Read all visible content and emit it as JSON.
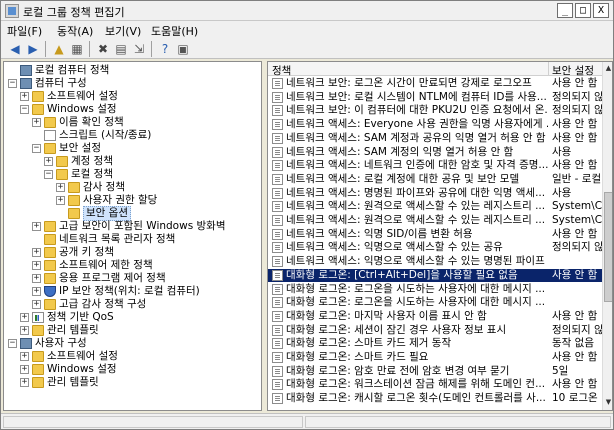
{
  "window": {
    "title": "로컬 그룹 정책 편집기",
    "controls": {
      "minimize": "_",
      "maximize": "□",
      "close": "X"
    }
  },
  "menu": [
    "파일(F)",
    "동작(A)",
    "보기(V)",
    "도움말(H)"
  ],
  "toolbar_icons": [
    "back-icon",
    "forward-icon",
    "up-icon",
    "show-hide-tree-icon",
    "delete-icon",
    "properties-icon",
    "export-icon",
    "help-icon",
    "view-icon"
  ],
  "tree": [
    {
      "label": "로컬 컴퓨터 정책",
      "icon": "computer",
      "exp": ""
    },
    {
      "label": "컴퓨터 구성",
      "icon": "computer",
      "exp": "−"
    },
    {
      "label": "소프트웨어 설정",
      "icon": "folder",
      "exp": "+"
    },
    {
      "label": "Windows 설정",
      "icon": "folder",
      "exp": "−"
    },
    {
      "label": "이름 확인 정책",
      "icon": "folder",
      "exp": "+"
    },
    {
      "label": "스크립트 (시작/종료)",
      "icon": "doc",
      "exp": ""
    },
    {
      "label": "보안 설정",
      "icon": "folder",
      "exp": "−"
    },
    {
      "label": "계정 정책",
      "icon": "folder",
      "exp": "+"
    },
    {
      "label": "로컬 정책",
      "icon": "folder",
      "exp": "−"
    },
    {
      "label": "감사 정책",
      "icon": "folder",
      "exp": "+"
    },
    {
      "label": "사용자 권한 할당",
      "icon": "folder",
      "exp": "+"
    },
    {
      "label": "보안 옵션",
      "icon": "folder",
      "exp": "",
      "selected": true
    },
    {
      "label": "고급 보안이 포함된 Windows 방화벽",
      "icon": "folder",
      "exp": "+"
    },
    {
      "label": "네트워크 목록 관리자 정책",
      "icon": "folder",
      "exp": ""
    },
    {
      "label": "공개 키 정책",
      "icon": "folder",
      "exp": "+"
    },
    {
      "label": "소프트웨어 제한 정책",
      "icon": "folder",
      "exp": "+"
    },
    {
      "label": "응용 프로그램 제어 정책",
      "icon": "folder",
      "exp": "+"
    },
    {
      "label": "IP 보안 정책(위치: 로컬 컴퓨터)",
      "icon": "shield",
      "exp": "+"
    },
    {
      "label": "고급 감사 정책 구성",
      "icon": "folder",
      "exp": "+"
    },
    {
      "label": "정책 기반 QoS",
      "icon": "chart",
      "exp": "+"
    },
    {
      "label": "관리 템플릿",
      "icon": "folder",
      "exp": "+"
    },
    {
      "label": "사용자 구성",
      "icon": "computer",
      "exp": "−"
    },
    {
      "label": "소프트웨어 설정",
      "icon": "folder",
      "exp": "+"
    },
    {
      "label": "Windows 설정",
      "icon": "folder",
      "exp": "+"
    },
    {
      "label": "관리 템플릿",
      "icon": "folder",
      "exp": "+"
    }
  ],
  "table": {
    "columns": [
      "정책",
      "보안 설정"
    ],
    "rows": [
      {
        "name": "네트워크 보안: 로그온 시간이 만료되면 강제로 로그오프",
        "setting": "사용 안 함"
      },
      {
        "name": "네트워크 보안: 로컬 시스템이 NTLM에 컴퓨터 ID를 사용...",
        "setting": "정의되지 않"
      },
      {
        "name": "네트워크 보안: 이 컴퓨터에 대한 PKU2U 인증 요청에서 온...",
        "setting": "정의되지 않"
      },
      {
        "name": "네트워크 액세스: Everyone 사용 권한을 익명 사용자에게 ...",
        "setting": "사용 안 함"
      },
      {
        "name": "네트워크 액세스: SAM 계정과 공유의 익명 열거 허용 안 함",
        "setting": "사용 안 함"
      },
      {
        "name": "네트워크 액세스: SAM 계정의 익명 열거 허용 안 함",
        "setting": "사용"
      },
      {
        "name": "네트워크 액세스: 네트워크 인증에 대한 암호 및 자격 증명...",
        "setting": "사용 안 함"
      },
      {
        "name": "네트워크 액세스: 로컬 계정에 대한 공유 및 보안 모델",
        "setting": "일반 - 로컬"
      },
      {
        "name": "네트워크 액세스: 명명된 파이프와 공유에 대한 익명 액세...",
        "setting": "사용"
      },
      {
        "name": "네트워크 액세스: 원격으로 액세스할 수 있는 레지스트리 ...",
        "setting": "System\\Curr"
      },
      {
        "name": "네트워크 액세스: 원격으로 액세스할 수 있는 레지스트리 ...",
        "setting": "System\\Curr"
      },
      {
        "name": "네트워크 액세스: 익명 SID/이름 변환 허용",
        "setting": "사용 안 함"
      },
      {
        "name": "네트워크 액세스: 익명으로 액세스할 수 있는 공유",
        "setting": "정의되지 않"
      },
      {
        "name": "네트워크 액세스: 익명으로 액세스할 수 있는 명명된 파이프",
        "setting": ""
      },
      {
        "name": "대화형 로그온: [Ctrl+Alt+Del]을 사용할 필요 없음",
        "setting": "사용 안 함",
        "selected": true
      },
      {
        "name": "대화형 로그온: 로그온을 시도하는 사용자에 대한 메시지 ...",
        "setting": ""
      },
      {
        "name": "대화형 로그온: 로그온을 시도하는 사용자에 대한 메시지 ...",
        "setting": ""
      },
      {
        "name": "대화형 로그온: 마지막 사용자 이름 표시 안 함",
        "setting": "사용 안 함"
      },
      {
        "name": "대화형 로그온: 세션이 잠긴 경우 사용자 정보 표시",
        "setting": "정의되지 않"
      },
      {
        "name": "대화형 로그온: 스마트 카드 제거 동작",
        "setting": "동작 없음"
      },
      {
        "name": "대화형 로그온: 스마트 카드 필요",
        "setting": "사용 안 함"
      },
      {
        "name": "대화형 로그온: 암호 만료 전에 암호 변경 여부 묻기",
        "setting": "5일"
      },
      {
        "name": "대화형 로그온: 워크스테이션 잠금 해제를 위해 도메인 컨...",
        "setting": "사용 안 함"
      },
      {
        "name": "대화형 로그온: 캐시할 로그온 횟수(도메인 컨트롤러를 사...",
        "setting": "10 로그온"
      }
    ]
  },
  "colors": {
    "selection": "#0a246a",
    "tree_selection": "#cfe3fc",
    "folder": "#f2c94c"
  }
}
